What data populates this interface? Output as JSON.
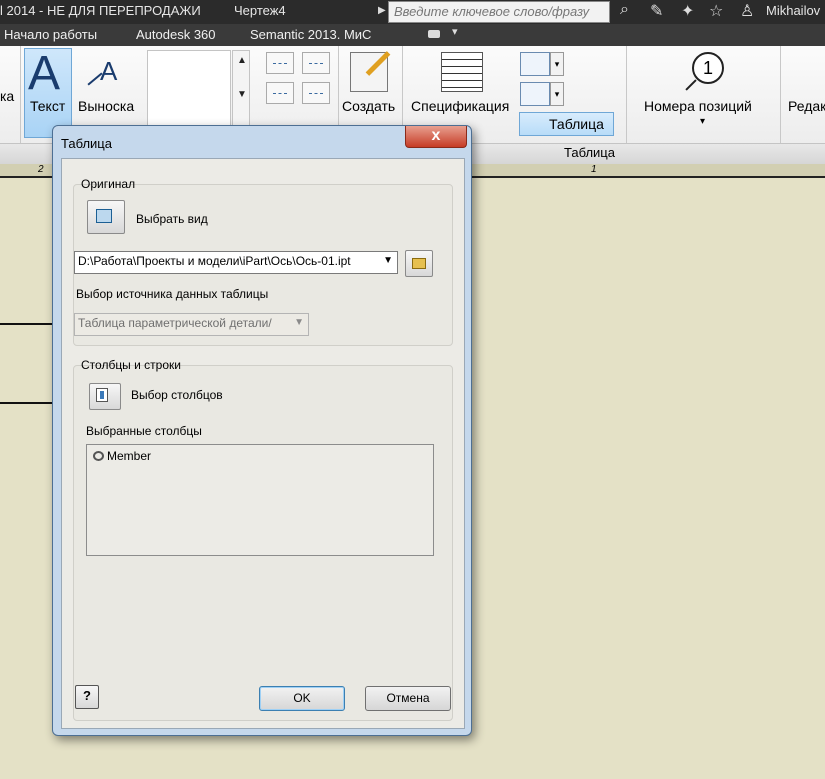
{
  "titlebar": {
    "app_title": "l 2014 - НЕ ДЛЯ ПЕРЕПРОДАЖИ",
    "document": "Чертеж4",
    "search_placeholder": "Введите ключевое слово/фразу",
    "user": "Mikhailov",
    "icons": [
      "binoculars-icon",
      "wrench-icon",
      "satellite-icon",
      "star-icon",
      "user-icon"
    ]
  },
  "menu": {
    "items": [
      "Начало работы",
      "Autodesk 360",
      "Semantic 2013. МиС"
    ]
  },
  "ribbon": {
    "left_cut": "ка",
    "text_label": "Текст",
    "leader_label": "Выноска",
    "create_label": "Создать",
    "spec_label": "Спецификация",
    "table_label": "Таблица",
    "balloon_number": "1",
    "balloon_label": "Номера позиций",
    "right_cut": "Редак",
    "panel_table": "Таблица"
  },
  "drawing": {
    "ruler_left": "2",
    "ruler_right": "1",
    "background": "#e4e1c6"
  },
  "dialog": {
    "title": "Таблица",
    "close_symbol": "x",
    "original": {
      "group_title": "Оригинал",
      "select_view_label": "Выбрать вид",
      "file_path": "D:\\Работа\\Проекты и модели\\iPart\\Ось\\Ось-01.ipt",
      "source_label": "Выбор источника данных таблицы",
      "source_value": "Таблица параметрической детали/"
    },
    "columns": {
      "group_title": "Столбцы и строки",
      "select_columns_label": "Выбор столбцов",
      "selected_label": "Выбранные столбцы",
      "items": [
        "Member"
      ]
    },
    "buttons": {
      "help": "?",
      "ok": "OK",
      "cancel": "Отмена"
    }
  }
}
